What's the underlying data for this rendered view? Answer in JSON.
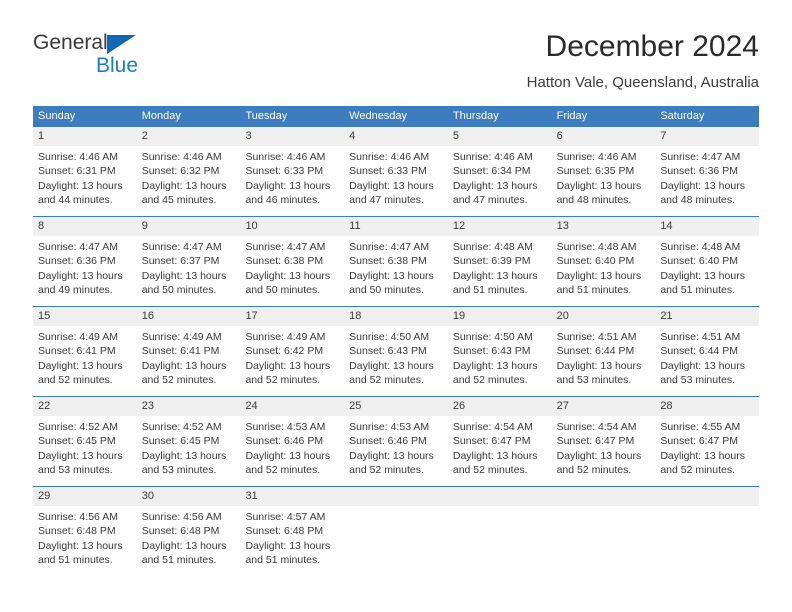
{
  "logo": {
    "word1": "General",
    "word2": "Blue",
    "triangle_color": "#1268b3",
    "blue_text_color": "#1d7ec4"
  },
  "header": {
    "title": "December 2024",
    "location": "Hatton Vale, Queensland, Australia"
  },
  "theme": {
    "header_bg": "#3c7cbf",
    "header_text": "#ffffff",
    "daynum_bg": "#efefef",
    "cell_bg": "#ffffff",
    "body_text": "#3a3a3a"
  },
  "calendar": {
    "weekday_headers": [
      "Sunday",
      "Monday",
      "Tuesday",
      "Wednesday",
      "Thursday",
      "Friday",
      "Saturday"
    ],
    "weeks": [
      {
        "daynums": [
          "1",
          "2",
          "3",
          "4",
          "5",
          "6",
          "7"
        ],
        "cells": [
          {
            "sunrise": "Sunrise: 4:46 AM",
            "sunset": "Sunset: 6:31 PM",
            "daylight": "Daylight: 13 hours and 44 minutes."
          },
          {
            "sunrise": "Sunrise: 4:46 AM",
            "sunset": "Sunset: 6:32 PM",
            "daylight": "Daylight: 13 hours and 45 minutes."
          },
          {
            "sunrise": "Sunrise: 4:46 AM",
            "sunset": "Sunset: 6:33 PM",
            "daylight": "Daylight: 13 hours and 46 minutes."
          },
          {
            "sunrise": "Sunrise: 4:46 AM",
            "sunset": "Sunset: 6:33 PM",
            "daylight": "Daylight: 13 hours and 47 minutes."
          },
          {
            "sunrise": "Sunrise: 4:46 AM",
            "sunset": "Sunset: 6:34 PM",
            "daylight": "Daylight: 13 hours and 47 minutes."
          },
          {
            "sunrise": "Sunrise: 4:46 AM",
            "sunset": "Sunset: 6:35 PM",
            "daylight": "Daylight: 13 hours and 48 minutes."
          },
          {
            "sunrise": "Sunrise: 4:47 AM",
            "sunset": "Sunset: 6:36 PM",
            "daylight": "Daylight: 13 hours and 48 minutes."
          }
        ]
      },
      {
        "daynums": [
          "8",
          "9",
          "10",
          "11",
          "12",
          "13",
          "14"
        ],
        "cells": [
          {
            "sunrise": "Sunrise: 4:47 AM",
            "sunset": "Sunset: 6:36 PM",
            "daylight": "Daylight: 13 hours and 49 minutes."
          },
          {
            "sunrise": "Sunrise: 4:47 AM",
            "sunset": "Sunset: 6:37 PM",
            "daylight": "Daylight: 13 hours and 50 minutes."
          },
          {
            "sunrise": "Sunrise: 4:47 AM",
            "sunset": "Sunset: 6:38 PM",
            "daylight": "Daylight: 13 hours and 50 minutes."
          },
          {
            "sunrise": "Sunrise: 4:47 AM",
            "sunset": "Sunset: 6:38 PM",
            "daylight": "Daylight: 13 hours and 50 minutes."
          },
          {
            "sunrise": "Sunrise: 4:48 AM",
            "sunset": "Sunset: 6:39 PM",
            "daylight": "Daylight: 13 hours and 51 minutes."
          },
          {
            "sunrise": "Sunrise: 4:48 AM",
            "sunset": "Sunset: 6:40 PM",
            "daylight": "Daylight: 13 hours and 51 minutes."
          },
          {
            "sunrise": "Sunrise: 4:48 AM",
            "sunset": "Sunset: 6:40 PM",
            "daylight": "Daylight: 13 hours and 51 minutes."
          }
        ]
      },
      {
        "daynums": [
          "15",
          "16",
          "17",
          "18",
          "19",
          "20",
          "21"
        ],
        "cells": [
          {
            "sunrise": "Sunrise: 4:49 AM",
            "sunset": "Sunset: 6:41 PM",
            "daylight": "Daylight: 13 hours and 52 minutes."
          },
          {
            "sunrise": "Sunrise: 4:49 AM",
            "sunset": "Sunset: 6:41 PM",
            "daylight": "Daylight: 13 hours and 52 minutes."
          },
          {
            "sunrise": "Sunrise: 4:49 AM",
            "sunset": "Sunset: 6:42 PM",
            "daylight": "Daylight: 13 hours and 52 minutes."
          },
          {
            "sunrise": "Sunrise: 4:50 AM",
            "sunset": "Sunset: 6:43 PM",
            "daylight": "Daylight: 13 hours and 52 minutes."
          },
          {
            "sunrise": "Sunrise: 4:50 AM",
            "sunset": "Sunset: 6:43 PM",
            "daylight": "Daylight: 13 hours and 52 minutes."
          },
          {
            "sunrise": "Sunrise: 4:51 AM",
            "sunset": "Sunset: 6:44 PM",
            "daylight": "Daylight: 13 hours and 53 minutes."
          },
          {
            "sunrise": "Sunrise: 4:51 AM",
            "sunset": "Sunset: 6:44 PM",
            "daylight": "Daylight: 13 hours and 53 minutes."
          }
        ]
      },
      {
        "daynums": [
          "22",
          "23",
          "24",
          "25",
          "26",
          "27",
          "28"
        ],
        "cells": [
          {
            "sunrise": "Sunrise: 4:52 AM",
            "sunset": "Sunset: 6:45 PM",
            "daylight": "Daylight: 13 hours and 53 minutes."
          },
          {
            "sunrise": "Sunrise: 4:52 AM",
            "sunset": "Sunset: 6:45 PM",
            "daylight": "Daylight: 13 hours and 53 minutes."
          },
          {
            "sunrise": "Sunrise: 4:53 AM",
            "sunset": "Sunset: 6:46 PM",
            "daylight": "Daylight: 13 hours and 52 minutes."
          },
          {
            "sunrise": "Sunrise: 4:53 AM",
            "sunset": "Sunset: 6:46 PM",
            "daylight": "Daylight: 13 hours and 52 minutes."
          },
          {
            "sunrise": "Sunrise: 4:54 AM",
            "sunset": "Sunset: 6:47 PM",
            "daylight": "Daylight: 13 hours and 52 minutes."
          },
          {
            "sunrise": "Sunrise: 4:54 AM",
            "sunset": "Sunset: 6:47 PM",
            "daylight": "Daylight: 13 hours and 52 minutes."
          },
          {
            "sunrise": "Sunrise: 4:55 AM",
            "sunset": "Sunset: 6:47 PM",
            "daylight": "Daylight: 13 hours and 52 minutes."
          }
        ]
      },
      {
        "daynums": [
          "29",
          "30",
          "31",
          "",
          "",
          "",
          ""
        ],
        "cells": [
          {
            "sunrise": "Sunrise: 4:56 AM",
            "sunset": "Sunset: 6:48 PM",
            "daylight": "Daylight: 13 hours and 51 minutes."
          },
          {
            "sunrise": "Sunrise: 4:56 AM",
            "sunset": "Sunset: 6:48 PM",
            "daylight": "Daylight: 13 hours and 51 minutes."
          },
          {
            "sunrise": "Sunrise: 4:57 AM",
            "sunset": "Sunset: 6:48 PM",
            "daylight": "Daylight: 13 hours and 51 minutes."
          },
          {
            "sunrise": "",
            "sunset": "",
            "daylight": ""
          },
          {
            "sunrise": "",
            "sunset": "",
            "daylight": ""
          },
          {
            "sunrise": "",
            "sunset": "",
            "daylight": ""
          },
          {
            "sunrise": "",
            "sunset": "",
            "daylight": ""
          }
        ]
      }
    ]
  }
}
